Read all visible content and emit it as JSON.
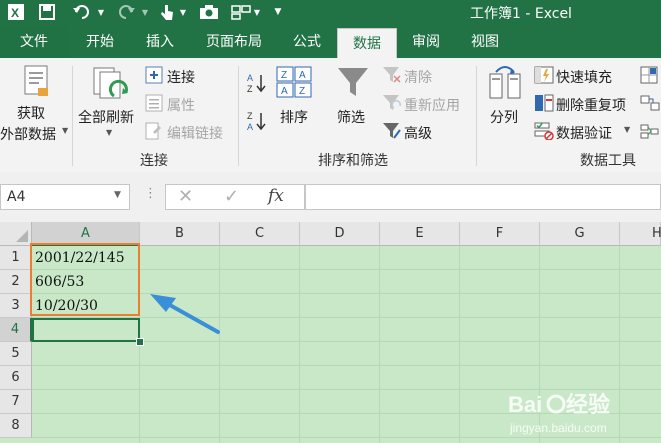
{
  "window": {
    "title": "工作簿1 - Excel"
  },
  "quick_access": {
    "icons": [
      "excel-logo-icon",
      "save-icon",
      "undo-icon",
      "redo-icon",
      "touch-mode-icon",
      "camera-icon",
      "layout-icon",
      "customize-icon"
    ]
  },
  "tabs": [
    {
      "label": "文件"
    },
    {
      "label": "开始"
    },
    {
      "label": "插入"
    },
    {
      "label": "页面布局"
    },
    {
      "label": "公式"
    },
    {
      "label": "数据",
      "active": true
    },
    {
      "label": "审阅"
    },
    {
      "label": "视图"
    }
  ],
  "ribbon": {
    "get_external": {
      "line1": "获取",
      "line2": "外部数据"
    },
    "refresh_all": "全部刷新",
    "connections": "连接",
    "properties": "属性",
    "edit_links": "编辑链接",
    "group_connections": "连接",
    "sort": "排序",
    "filter": "筛选",
    "clear": "清除",
    "reapply": "重新应用",
    "advanced": "高级",
    "group_sort_filter": "排序和筛选",
    "text_to_columns": "分列",
    "flash_fill": "快速填充",
    "remove_duplicates": "删除重复项",
    "data_validation": "数据验证",
    "group_data_tools": "数据工具",
    "sort_az": "A Z",
    "sort_za": "Z A"
  },
  "formula_bar": {
    "name_box": "A4",
    "fx": "fx",
    "formula": ""
  },
  "sheet": {
    "columns": [
      "A",
      "B",
      "C",
      "D",
      "E",
      "F",
      "G",
      "H"
    ],
    "rows": [
      "1",
      "2",
      "3",
      "4",
      "5",
      "6",
      "7",
      "8"
    ],
    "cells": {
      "A1": "2001/22/145",
      "A2": "606/53",
      "A3": "10/20/30"
    }
  },
  "colors": {
    "excel_green": "#217346",
    "highlight_orange": "#ed7d31",
    "arrow_blue": "#3a8fd6",
    "sheet_bg": "#c8e8c8"
  }
}
